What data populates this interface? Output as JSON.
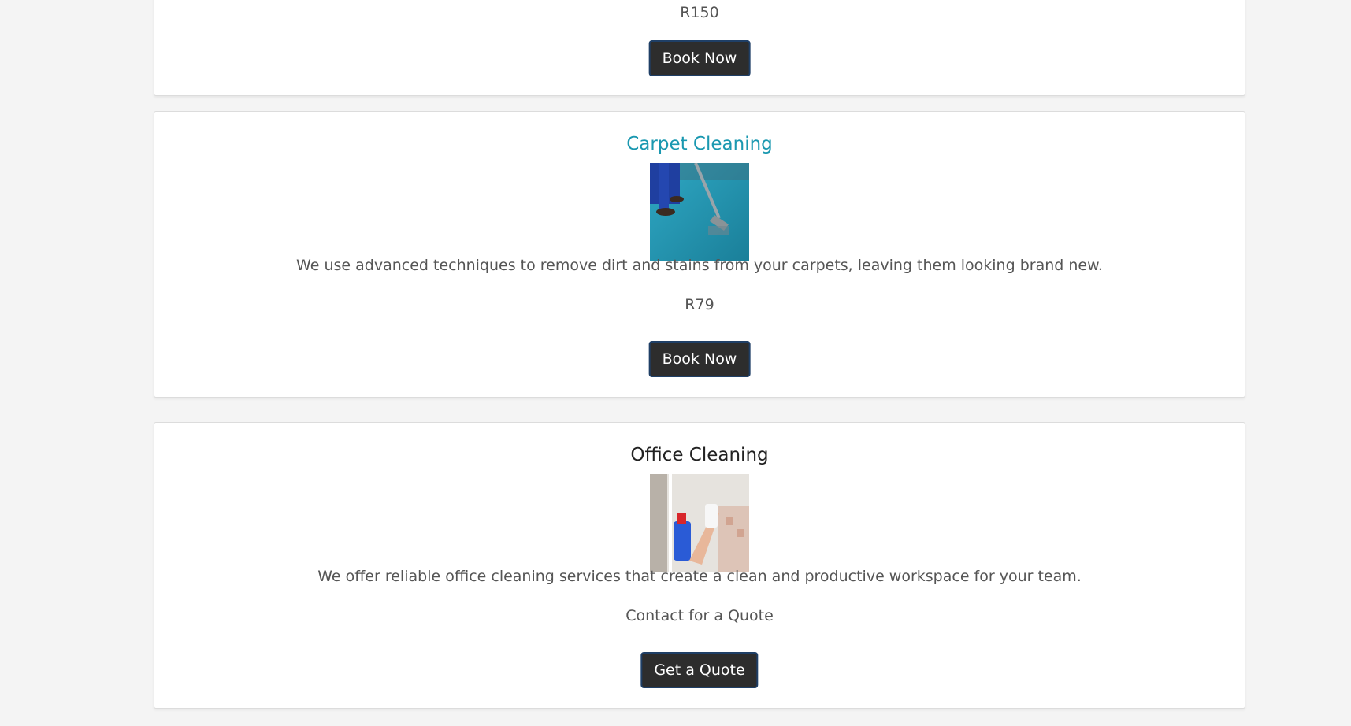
{
  "services": {
    "previous": {
      "price": "R150",
      "button_label": "Book Now"
    },
    "carpet": {
      "title": "Carpet Cleaning",
      "image_alt": "carpet-cleaning-photo",
      "description": "We use advanced techniques to remove dirt and stains from your carpets, leaving them looking brand new.",
      "price": "R79",
      "button_label": "Book Now"
    },
    "office": {
      "title": "Office Cleaning",
      "image_alt": "office-cleaning-photo",
      "description": "We offer reliable office cleaning services that create a clean and productive workspace for your team.",
      "price": "Contact for a Quote",
      "button_label": "Get a Quote"
    }
  },
  "colors": {
    "page_background": "#f4f4f4",
    "accent_title": "#1a98b0",
    "button_background": "#2d2d2d",
    "button_border": "#1f3f66"
  }
}
